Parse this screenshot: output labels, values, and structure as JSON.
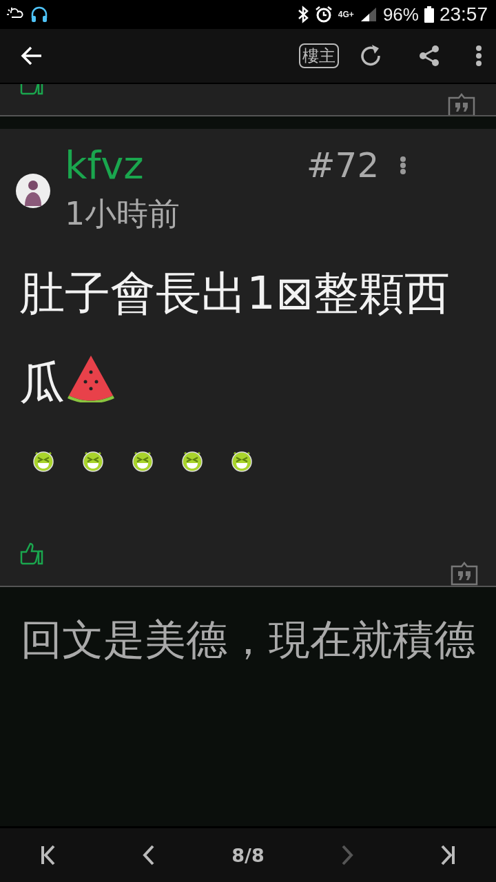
{
  "status_bar": {
    "network": "4G+",
    "battery": "96%",
    "time": "23:57"
  },
  "toolbar": {
    "op_filter": "樓主"
  },
  "previous_post": {
    "liked": false
  },
  "post": {
    "author": "kfvz",
    "floor": "#72",
    "time": "1小時前",
    "body": "肚子會長出1⊠整顆西瓜",
    "emoticons": [
      {
        "kind": "laugh"
      },
      {
        "kind": "laugh"
      },
      {
        "kind": "laugh"
      },
      {
        "kind": "laugh"
      },
      {
        "kind": "laugh"
      }
    ],
    "liked": false
  },
  "reply": {
    "placeholder": "回文是美德，現在就積德"
  },
  "pager": {
    "page": "8/8",
    "buttons": [
      {
        "kind": "first",
        "disabled": false
      },
      {
        "kind": "prev",
        "disabled": false
      },
      {
        "kind": "next",
        "disabled": true
      },
      {
        "kind": "last",
        "disabled": false
      }
    ]
  }
}
